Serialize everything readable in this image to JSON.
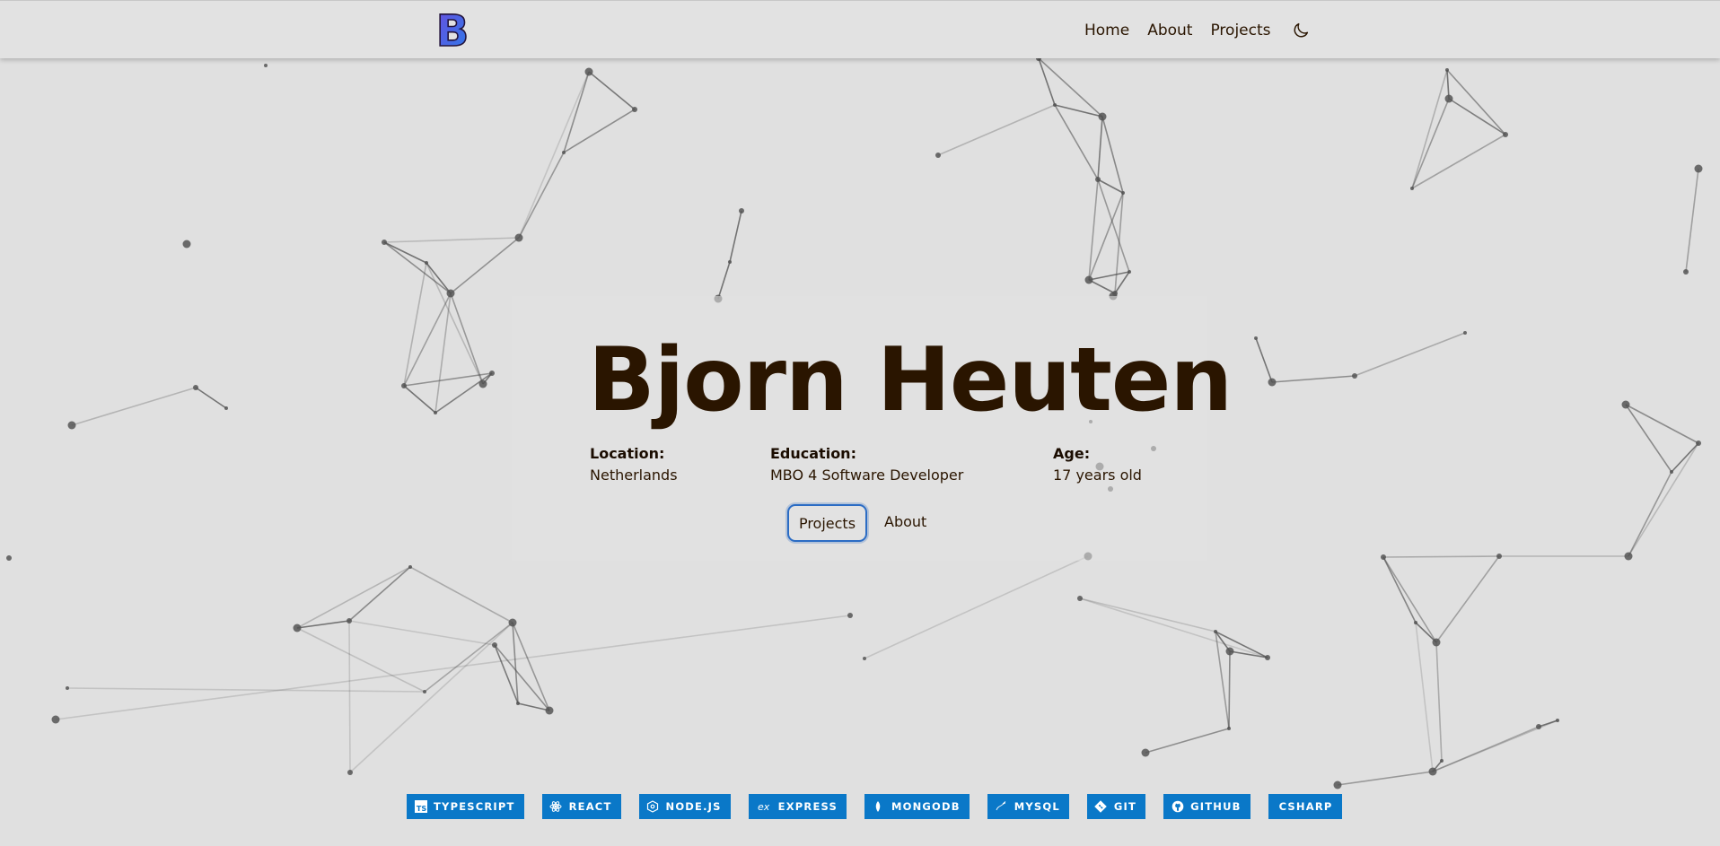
{
  "header": {
    "logo_letter": "B",
    "nav": [
      "Home",
      "About",
      "Projects"
    ],
    "theme_toggle_icon": "moon-icon"
  },
  "hero": {
    "name": "Bjorn Heuten",
    "info": [
      {
        "label": "Location:",
        "value": "Netherlands"
      },
      {
        "label": "Education:",
        "value": "MBO 4 Software Developer"
      },
      {
        "label": "Age:",
        "value": "17 years old"
      }
    ],
    "buttons": {
      "projects": "Projects",
      "about": "About"
    }
  },
  "skills": [
    {
      "label": "TYPESCRIPT",
      "icon": "typescript-icon"
    },
    {
      "label": "REACT",
      "icon": "react-icon"
    },
    {
      "label": "NODE.JS",
      "icon": "nodejs-icon"
    },
    {
      "label": "EXPRESS",
      "icon": "express-icon"
    },
    {
      "label": "MONGODB",
      "icon": "mongodb-icon"
    },
    {
      "label": "MYSQL",
      "icon": "mysql-icon"
    },
    {
      "label": "GIT",
      "icon": "git-icon"
    },
    {
      "label": "GITHUB",
      "icon": "github-icon"
    },
    {
      "label": "CSHARP",
      "icon": ""
    }
  ],
  "colors": {
    "background": "#e0e0e0",
    "text": "#2a1500",
    "badge": "#0a78c8",
    "button_border": "#2b6cc4",
    "logo_gradient": [
      "#6a4fe0",
      "#2a7be8"
    ]
  }
}
